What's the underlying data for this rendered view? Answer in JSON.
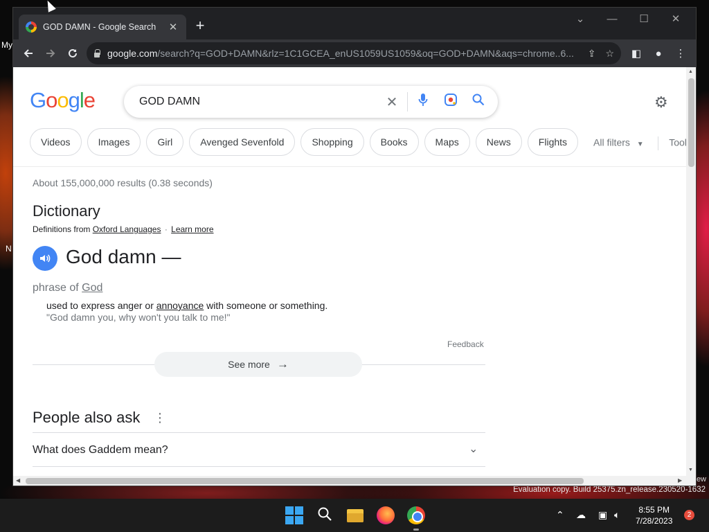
{
  "desktop": {
    "labels": [
      "My",
      "N"
    ],
    "watermark": "Evaluation copy. Build 25375.zn_release.230520-1632",
    "watermark_prev": "ew"
  },
  "browser": {
    "tab": {
      "title": "GOD DAMN - Google Search",
      "close": "✕"
    },
    "new_tab": "+",
    "window_controls": [
      "⌄",
      "—",
      "☐",
      "✕"
    ],
    "url": {
      "host": "google.com",
      "path": "/search?q=GOD+DAMN&rlz=1C1GCEA_enUS1059US1059&oq=GOD+DAMN&aqs=chrome..6..."
    }
  },
  "page": {
    "logo": [
      "G",
      "o",
      "o",
      "g",
      "l",
      "e"
    ],
    "query": "GOD DAMN",
    "chips": [
      "Videos",
      "Images",
      "Girl",
      "Avenged Sevenfold",
      "Shopping",
      "Books",
      "Maps",
      "News",
      "Flights"
    ],
    "all_filters": "All filters",
    "tools": "Tools",
    "stats": "About 155,000,000 results (0.38 seconds)",
    "dictionary": {
      "heading": "Dictionary",
      "defs_from": "Definitions from",
      "source": "Oxford Languages",
      "dot": "·",
      "learn_more": "Learn more",
      "word": "God damn —",
      "pos_prefix": "phrase of",
      "pos_link": "God",
      "def_pre": "used to express anger or",
      "def_link": "annoyance",
      "def_post": "with someone or something.",
      "example": "\"God damn you, why won't you talk to me!\"",
      "feedback": "Feedback",
      "see_more": "See more"
    },
    "people_also_ask": {
      "heading": "People also ask",
      "questions": [
        "What does Gaddem mean?"
      ]
    }
  },
  "taskbar": {
    "time": "8:55 PM",
    "date": "7/28/2023",
    "notifications": "2"
  }
}
